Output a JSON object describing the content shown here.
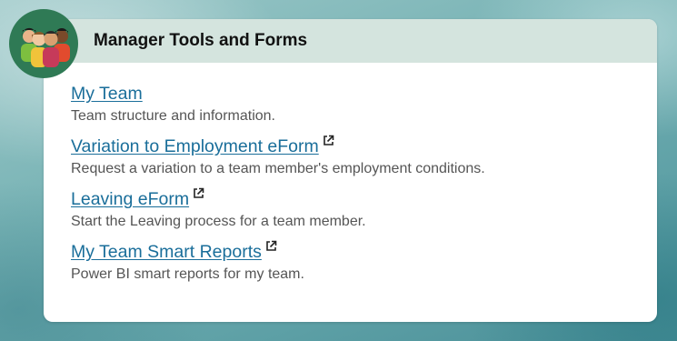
{
  "card": {
    "title": "Manager Tools and Forms",
    "avatar_icon": "team-people-icon",
    "items": [
      {
        "label": "My Team",
        "description": "Team structure and information.",
        "external": false
      },
      {
        "label": "Variation to Employment eForm",
        "description": "Request a variation to a team member's employment conditions.",
        "external": true
      },
      {
        "label": "Leaving eForm",
        "description": "Start the Leaving process for a team member.",
        "external": true
      },
      {
        "label": "My Team Smart Reports",
        "description": "Power BI smart reports for my team.",
        "external": true
      }
    ]
  },
  "colors": {
    "header_bg": "#d4e4de",
    "link": "#1a6e9a",
    "description": "#555555",
    "avatar_bg": "#2f7a55"
  }
}
